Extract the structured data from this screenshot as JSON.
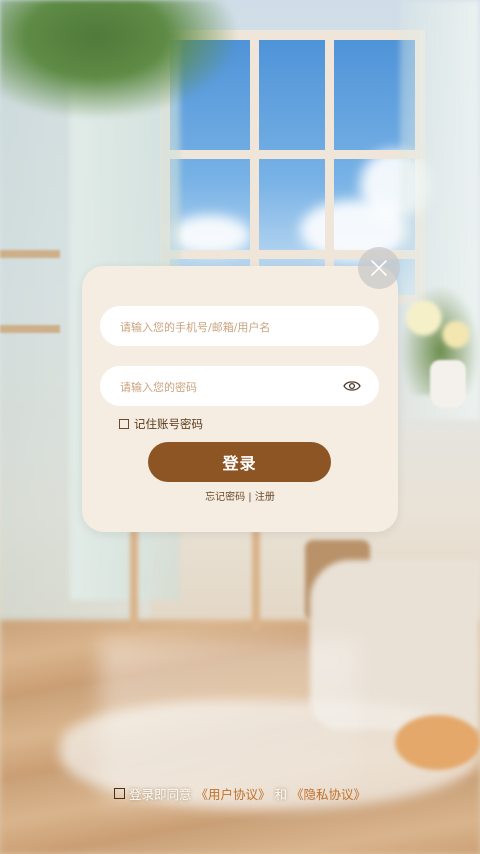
{
  "login": {
    "account_placeholder": "请输入您的手机号/邮箱/用户名",
    "password_placeholder": "请输入您的密码",
    "remember_label": "记住账号密码",
    "login_button": "登录",
    "forgot_password": "忘记密码",
    "separator": " | ",
    "register": "注册"
  },
  "agreement": {
    "prefix": "登录即同意",
    "user_agreement": "《用户协议》",
    "conjunction": "和",
    "privacy_policy": "《隐私协议》"
  },
  "colors": {
    "card_background": "#f5ede1",
    "primary_button": "#8d5524",
    "link_accent": "#c0712c"
  },
  "icons": {
    "close": "close-icon",
    "password_visibility": "eye-icon",
    "checkbox": "checkbox-icon"
  }
}
